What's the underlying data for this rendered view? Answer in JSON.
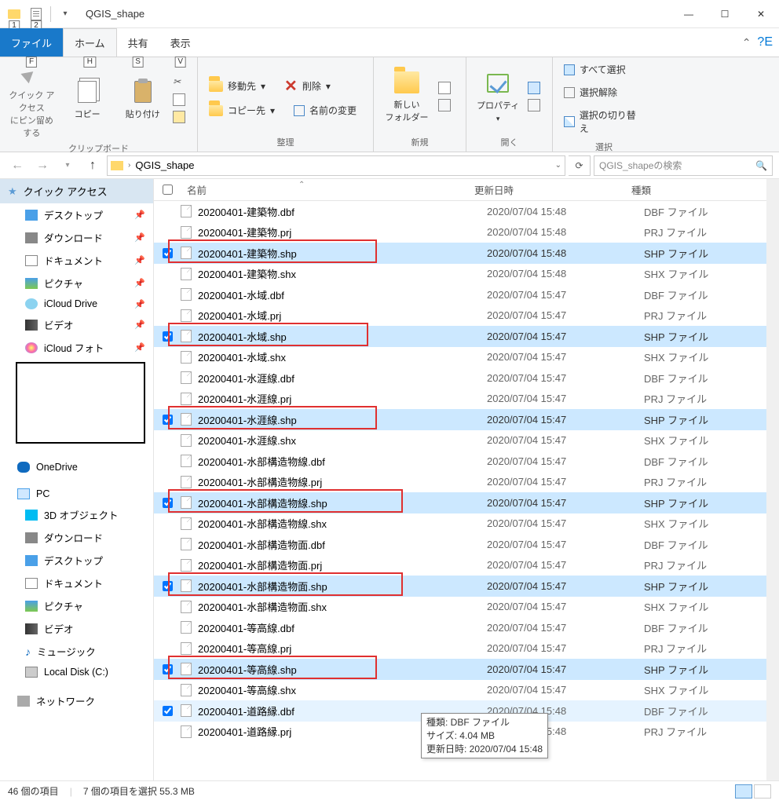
{
  "title": "QGIS_shape",
  "ribbon": {
    "tabs": {
      "file": "ファイル",
      "home": "ホーム",
      "share": "共有",
      "view": "表示"
    },
    "keys": {
      "qat1": "1",
      "qat2": "2",
      "file": "F",
      "home": "H",
      "share": "S",
      "view": "V",
      "help_badge": "E"
    },
    "clipboard": {
      "pin": "クイック アクセス\nにピン留めする",
      "copy": "コピー",
      "paste": "貼り付け",
      "group": "クリップボード"
    },
    "organize": {
      "moveTo": "移動先",
      "copyTo": "コピー先",
      "delete": "削除",
      "rename": "名前の変更",
      "group": "整理"
    },
    "new": {
      "newFolder": "新しい\nフォルダー",
      "group": "新規"
    },
    "open": {
      "properties": "プロパティ",
      "group": "開く"
    },
    "select": {
      "all": "すべて選択",
      "none": "選択解除",
      "invert": "選択の切り替え",
      "group": "選択"
    }
  },
  "addr": {
    "crumb": "QGIS_shape"
  },
  "search": {
    "placeholder": "QGIS_shapeの検索"
  },
  "nav": {
    "quick": "クイック アクセス",
    "quickItems": [
      {
        "label": "デスクトップ",
        "ico": "ico-desktop",
        "pin": true
      },
      {
        "label": "ダウンロード",
        "ico": "ico-dl",
        "pin": true
      },
      {
        "label": "ドキュメント",
        "ico": "ico-doc",
        "pin": true
      },
      {
        "label": "ピクチャ",
        "ico": "ico-pic",
        "pin": true
      },
      {
        "label": "iCloud Drive",
        "ico": "ico-cloud",
        "pin": true
      },
      {
        "label": "ビデオ",
        "ico": "ico-video",
        "pin": true
      },
      {
        "label": "iCloud フォト",
        "ico": "ico-photo",
        "pin": true
      }
    ],
    "onedrive": "OneDrive",
    "pc": "PC",
    "pcItems": [
      {
        "label": "3D オブジェクト",
        "ico": "ico-3d"
      },
      {
        "label": "ダウンロード",
        "ico": "ico-dl"
      },
      {
        "label": "デスクトップ",
        "ico": "ico-desktop"
      },
      {
        "label": "ドキュメント",
        "ico": "ico-doc"
      },
      {
        "label": "ピクチャ",
        "ico": "ico-pic"
      },
      {
        "label": "ビデオ",
        "ico": "ico-video"
      },
      {
        "label": "ミュージック",
        "ico": "ico-music"
      },
      {
        "label": "Local Disk (C:)",
        "ico": "ico-disk"
      }
    ],
    "network": "ネットワーク"
  },
  "columns": {
    "name": "名前",
    "date": "更新日時",
    "type": "種類"
  },
  "files": [
    {
      "name": "20200401-建築物.dbf",
      "date": "2020/07/04 15:48",
      "type": "DBF ファイル",
      "sel": false,
      "ck": false,
      "red": false
    },
    {
      "name": "20200401-建築物.prj",
      "date": "2020/07/04 15:48",
      "type": "PRJ ファイル",
      "sel": false,
      "ck": false,
      "red": false
    },
    {
      "name": "20200401-建築物.shp",
      "date": "2020/07/04 15:48",
      "type": "SHP ファイル",
      "sel": true,
      "ck": true,
      "red": true
    },
    {
      "name": "20200401-建築物.shx",
      "date": "2020/07/04 15:48",
      "type": "SHX ファイル",
      "sel": false,
      "ck": false,
      "red": false
    },
    {
      "name": "20200401-水域.dbf",
      "date": "2020/07/04 15:47",
      "type": "DBF ファイル",
      "sel": false,
      "ck": false,
      "red": false
    },
    {
      "name": "20200401-水域.prj",
      "date": "2020/07/04 15:47",
      "type": "PRJ ファイル",
      "sel": false,
      "ck": false,
      "red": false
    },
    {
      "name": "20200401-水域.shp",
      "date": "2020/07/04 15:47",
      "type": "SHP ファイル",
      "sel": true,
      "ck": true,
      "red": true
    },
    {
      "name": "20200401-水域.shx",
      "date": "2020/07/04 15:47",
      "type": "SHX ファイル",
      "sel": false,
      "ck": false,
      "red": false
    },
    {
      "name": "20200401-水涯線.dbf",
      "date": "2020/07/04 15:47",
      "type": "DBF ファイル",
      "sel": false,
      "ck": false,
      "red": false
    },
    {
      "name": "20200401-水涯線.prj",
      "date": "2020/07/04 15:47",
      "type": "PRJ ファイル",
      "sel": false,
      "ck": false,
      "red": false
    },
    {
      "name": "20200401-水涯線.shp",
      "date": "2020/07/04 15:47",
      "type": "SHP ファイル",
      "sel": true,
      "ck": true,
      "red": true
    },
    {
      "name": "20200401-水涯線.shx",
      "date": "2020/07/04 15:47",
      "type": "SHX ファイル",
      "sel": false,
      "ck": false,
      "red": false
    },
    {
      "name": "20200401-水部構造物線.dbf",
      "date": "2020/07/04 15:47",
      "type": "DBF ファイル",
      "sel": false,
      "ck": false,
      "red": false
    },
    {
      "name": "20200401-水部構造物線.prj",
      "date": "2020/07/04 15:47",
      "type": "PRJ ファイル",
      "sel": false,
      "ck": false,
      "red": false
    },
    {
      "name": "20200401-水部構造物線.shp",
      "date": "2020/07/04 15:47",
      "type": "SHP ファイル",
      "sel": true,
      "ck": true,
      "red": true
    },
    {
      "name": "20200401-水部構造物線.shx",
      "date": "2020/07/04 15:47",
      "type": "SHX ファイル",
      "sel": false,
      "ck": false,
      "red": false
    },
    {
      "name": "20200401-水部構造物面.dbf",
      "date": "2020/07/04 15:47",
      "type": "DBF ファイル",
      "sel": false,
      "ck": false,
      "red": false
    },
    {
      "name": "20200401-水部構造物面.prj",
      "date": "2020/07/04 15:47",
      "type": "PRJ ファイル",
      "sel": false,
      "ck": false,
      "red": false
    },
    {
      "name": "20200401-水部構造物面.shp",
      "date": "2020/07/04 15:47",
      "type": "SHP ファイル",
      "sel": true,
      "ck": true,
      "red": true
    },
    {
      "name": "20200401-水部構造物面.shx",
      "date": "2020/07/04 15:47",
      "type": "SHX ファイル",
      "sel": false,
      "ck": false,
      "red": false
    },
    {
      "name": "20200401-等高線.dbf",
      "date": "2020/07/04 15:47",
      "type": "DBF ファイル",
      "sel": false,
      "ck": false,
      "red": false
    },
    {
      "name": "20200401-等高線.prj",
      "date": "2020/07/04 15:47",
      "type": "PRJ ファイル",
      "sel": false,
      "ck": false,
      "red": false
    },
    {
      "name": "20200401-等高線.shp",
      "date": "2020/07/04 15:47",
      "type": "SHP ファイル",
      "sel": true,
      "ck": true,
      "red": true
    },
    {
      "name": "20200401-等高線.shx",
      "date": "2020/07/04 15:47",
      "type": "SHX ファイル",
      "sel": false,
      "ck": false,
      "red": false
    },
    {
      "name": "20200401-道路縁.dbf",
      "date": "2020/07/04 15:48",
      "type": "DBF ファイル",
      "sel": false,
      "ck": true,
      "red": false,
      "hover": true
    },
    {
      "name": "20200401-道路縁.prj",
      "date": "2020/07/04 15:48",
      "type": "PRJ ファイル",
      "sel": false,
      "ck": false,
      "red": false
    }
  ],
  "tooltip": {
    "l1": "種類: DBF ファイル",
    "l2": "サイズ: 4.04 MB",
    "l3": "更新日時: 2020/07/04 15:48"
  },
  "status": {
    "count": "46 個の項目",
    "selection": "7 個の項目を選択  55.3 MB"
  }
}
